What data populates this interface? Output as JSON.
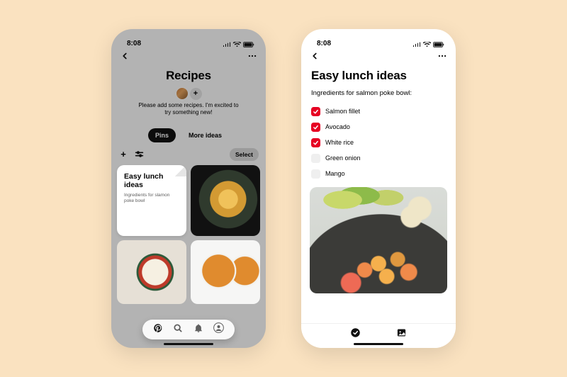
{
  "status_time": "8:08",
  "left": {
    "title": "Recipes",
    "description": "Please add some recipes. I'm excited to try something new!",
    "tabs": {
      "pins": "Pins",
      "more": "More ideas"
    },
    "select": "Select",
    "note": {
      "title": "Easy lunch ideas",
      "subtitle": "Ingredients for slamon poke bowl"
    }
  },
  "right": {
    "title": "Easy lunch ideas",
    "subtitle": "Ingredients for salmon poke bowl:",
    "ingredients": [
      {
        "label": "Salmon fillet",
        "checked": true
      },
      {
        "label": "Avocado",
        "checked": true
      },
      {
        "label": "White rice",
        "checked": true
      },
      {
        "label": "Green onion",
        "checked": false
      },
      {
        "label": "Mango",
        "checked": false
      }
    ]
  }
}
